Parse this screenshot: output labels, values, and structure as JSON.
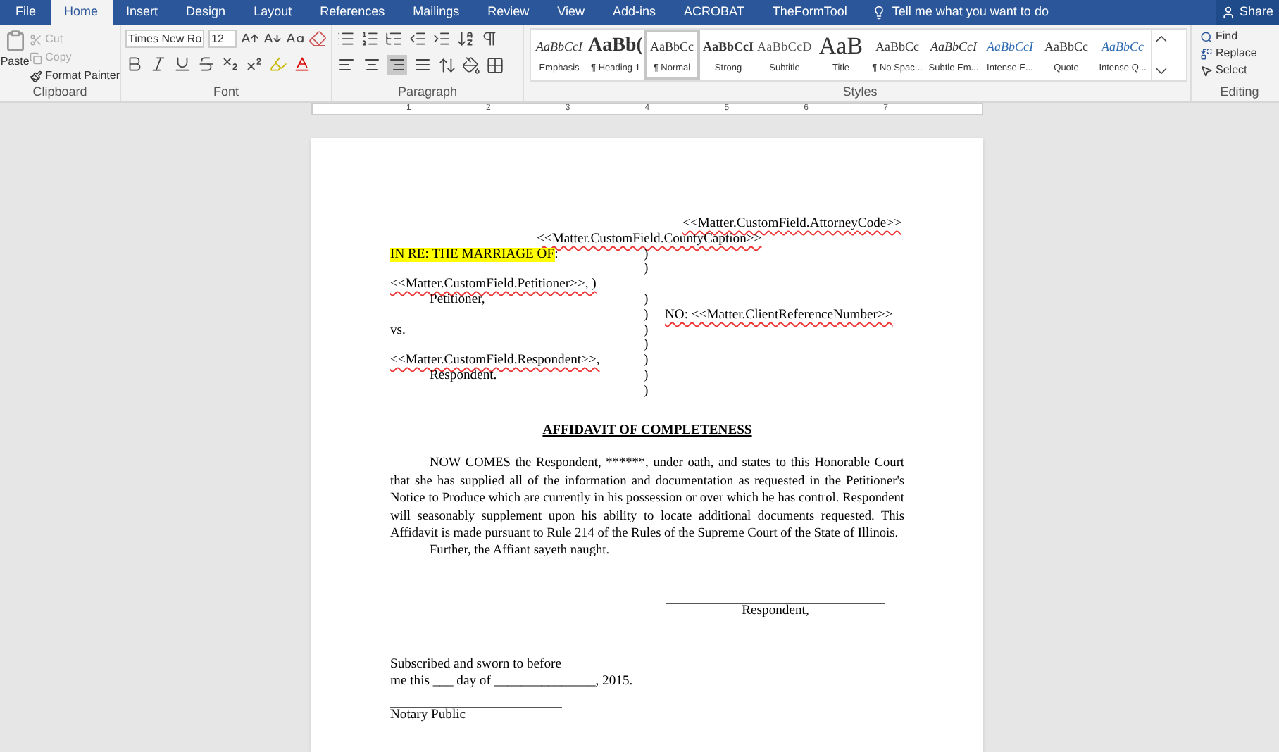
{
  "tabs": [
    {
      "label": "File",
      "selected": false
    },
    {
      "label": "Home",
      "selected": true
    },
    {
      "label": "Insert",
      "selected": false
    },
    {
      "label": "Design",
      "selected": false
    },
    {
      "label": "Layout",
      "selected": false
    },
    {
      "label": "References",
      "selected": false
    },
    {
      "label": "Mailings",
      "selected": false
    },
    {
      "label": "Review",
      "selected": false
    },
    {
      "label": "View",
      "selected": false
    },
    {
      "label": "Add-ins",
      "selected": false
    },
    {
      "label": "ACROBAT",
      "selected": false
    },
    {
      "label": "TheFormTool",
      "selected": false
    }
  ],
  "tell_me": "Tell me what you want to do",
  "share": "Share",
  "clipboard": {
    "label": "Clipboard",
    "paste": "Paste",
    "items": [
      {
        "kind": "cut",
        "label": "Cut",
        "disabled": true
      },
      {
        "kind": "copy",
        "label": "Copy",
        "disabled": true
      },
      {
        "kind": "painter",
        "label": "Format Painter",
        "disabled": false
      }
    ]
  },
  "font": {
    "label": "Font",
    "font_name": "Times New Ro",
    "font_size": "12"
  },
  "paragraph": {
    "label": "Paragraph",
    "alignment": [
      {
        "kind": "left",
        "selected": false
      },
      {
        "kind": "center",
        "selected": false
      },
      {
        "kind": "right",
        "selected": true
      },
      {
        "kind": "justify",
        "selected": false
      }
    ]
  },
  "styles": {
    "label": "Styles",
    "items": [
      {
        "preview": "AaBbCcI",
        "name": "Emphasis",
        "kind": "italic",
        "selected": false
      },
      {
        "preview": "AaBb(",
        "name": "¶ Heading 1",
        "kind": "heading",
        "selected": false
      },
      {
        "preview": "AaBbCc",
        "name": "¶ Normal",
        "kind": "plain",
        "selected": true
      },
      {
        "preview": "AaBbCcI",
        "name": "Strong",
        "kind": "bold",
        "selected": false
      },
      {
        "preview": "AaBbCcD",
        "name": "Subtitle",
        "kind": "spaced",
        "selected": false
      },
      {
        "preview": "AaB",
        "name": "Title",
        "kind": "title",
        "selected": false
      },
      {
        "preview": "AaBbCc",
        "name": "¶ No Spac...",
        "kind": "plain",
        "selected": false
      },
      {
        "preview": "AaBbCcI",
        "name": "Subtle Em...",
        "kind": "italic",
        "selected": false
      },
      {
        "preview": "AaBbCcI",
        "name": "Intense E...",
        "kind": "blue-italic",
        "selected": false
      },
      {
        "preview": "AaBbCc",
        "name": "Quote",
        "kind": "plain",
        "selected": false
      },
      {
        "preview": "AaBbCc",
        "name": "Intense Q...",
        "kind": "blue-italic",
        "selected": false
      }
    ]
  },
  "editing": {
    "label": "Editing",
    "find": "Find",
    "replace": "Replace",
    "select": "Select"
  },
  "ruler": [
    "1",
    "2",
    "3",
    "4",
    "5",
    "6",
    "7"
  ],
  "document": {
    "attorney_code": {
      "text": "<<Matter.CustomField.AttorneyCode>>",
      "misspelled": true
    },
    "county_caption": {
      "text": "<<Matter.CustomField.CountyCaption>>",
      "misspelled": true
    },
    "caption_rows": [
      {
        "left": "IN RE: THE MARRIAGE OF",
        "highlighted": true,
        "left_tail": ":",
        "paren": ")"
      },
      {
        "paren": ")"
      },
      {
        "left": "<<Matter.CustomField.Petitioner>>, )",
        "misspelled": true
      },
      {
        "left": "Petitioner,",
        "indent": true,
        "paren": ")"
      },
      {
        "paren": ")",
        "right": "NO: <<Matter.ClientReferenceNumber>>",
        "misspelled": true
      },
      {
        "left": "vs.",
        "paren": ")"
      },
      {
        "paren": ")"
      },
      {
        "left": "<<Matter.CustomField.Respondent>>,",
        "misspelled": true,
        "paren": ")"
      },
      {
        "left": "Respondent.",
        "indent": true,
        "paren": ")"
      },
      {
        "paren": ")"
      }
    ],
    "title": "AFFIDAVIT OF COMPLETENESS",
    "paragraphs": [
      "NOW COMES the Respondent, ******, under oath, and states to this Honorable Court that she has supplied all of the information and documentation as requested in the Petitioner's Notice to Produce which are currently in his possession or over which he has control. Respondent will seasonably supplement upon his ability to locate additional documents requested. This Affidavit is made pursuant to Rule 214 of the Rules of the Supreme Court of the State of Illinois.",
      "Further, the Affiant sayeth naught."
    ],
    "signature_label": "Respondent,",
    "jurat": [
      "Subscribed and sworn to before",
      "me this ___ day of _______________, 2015."
    ],
    "notary_label": "Notary Public"
  }
}
